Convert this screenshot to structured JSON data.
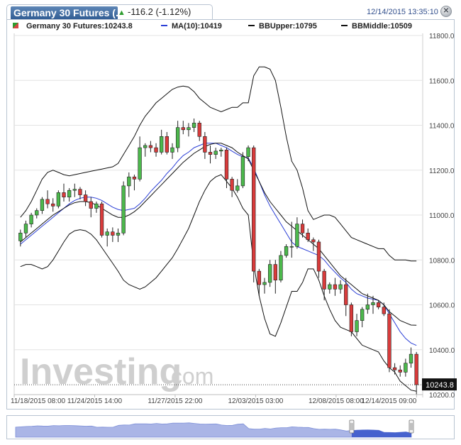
{
  "header": {
    "tab_title": "Germany 30 Futures (...",
    "change_arrow": "▲",
    "change": "-116.2 (-1.12%)",
    "datetime": "12/14/2015 13:35:10",
    "close_icon": "close-icon"
  },
  "legend": {
    "symbol": "Germany 30 Futures:10243.8",
    "ma": "MA(10):10419",
    "bb_upper": "BBUpper:10795",
    "bb_middle": "BBMiddle:10509"
  },
  "colors": {
    "up": "#4cb84c",
    "down": "#d93b3b",
    "ma": "#2b3fd6",
    "bb": "#111111",
    "grid": "#e3e3e3",
    "last_price_bg": "#111111",
    "navigator_fill": "#aab5e6",
    "navigator_selected": "#3553c9"
  },
  "watermark": {
    "brand": "Investing",
    "suffix": ".com"
  },
  "chart_data": {
    "type": "candlestick",
    "title": "Germany 30 Futures",
    "ylim": [
      10200,
      11800
    ],
    "y_ticks": [
      "11800.0",
      "11600.0",
      "11400.0",
      "11200.0",
      "11000.0",
      "10800.0",
      "10600.0",
      "10400.0",
      "10200.0"
    ],
    "x_ticks": [
      "11/18/2015 08:00",
      "11/24/2015 14:00",
      "11/27/2015 22:00",
      "12/03/2015 03:00",
      "12/08/2015 08:00",
      "12/14/2015 09:00"
    ],
    "last_price": "10243.8",
    "grid": true,
    "series": [
      {
        "name": "Germany 30 Futures",
        "kind": "ohlc",
        "candles": [
          [
            10885,
            10935,
            10860,
            10920
          ],
          [
            10920,
            10975,
            10900,
            10960
          ],
          [
            10960,
            11010,
            10945,
            11000
          ],
          [
            11000,
            11030,
            10985,
            11020
          ],
          [
            11020,
            11080,
            11005,
            11070
          ],
          [
            11070,
            11110,
            11030,
            11050
          ],
          [
            11050,
            11075,
            11015,
            11040
          ],
          [
            11040,
            11110,
            11030,
            11100
          ],
          [
            11100,
            11140,
            11060,
            11080
          ],
          [
            11080,
            11120,
            11060,
            11110
          ],
          [
            11110,
            11140,
            11080,
            11115
          ],
          [
            11115,
            11125,
            11070,
            11090
          ],
          [
            11090,
            11110,
            11040,
            11060
          ],
          [
            11060,
            11080,
            10990,
            11030
          ],
          [
            11030,
            11060,
            11010,
            11050
          ],
          [
            11050,
            11060,
            10900,
            10910
          ],
          [
            10910,
            10940,
            10860,
            10925
          ],
          [
            10925,
            10945,
            10880,
            10910
          ],
          [
            10910,
            10940,
            10880,
            10920
          ],
          [
            10920,
            11150,
            10910,
            11130
          ],
          [
            11130,
            11190,
            11080,
            11170
          ],
          [
            11170,
            11180,
            11110,
            11160
          ],
          [
            11160,
            11350,
            11150,
            11300
          ],
          [
            11300,
            11320,
            11260,
            11310
          ],
          [
            11310,
            11330,
            11280,
            11300
          ],
          [
            11300,
            11320,
            11260,
            11280
          ],
          [
            11280,
            11380,
            11270,
            11350
          ],
          [
            11350,
            11370,
            11270,
            11280
          ],
          [
            11280,
            11320,
            11250,
            11300
          ],
          [
            11300,
            11420,
            11280,
            11390
          ],
          [
            11390,
            11420,
            11360,
            11380
          ],
          [
            11380,
            11410,
            11350,
            11390
          ],
          [
            11390,
            11430,
            11370,
            11410
          ],
          [
            11410,
            11420,
            11330,
            11350
          ],
          [
            11350,
            11370,
            11250,
            11280
          ],
          [
            11280,
            11310,
            11230,
            11270
          ],
          [
            11270,
            11300,
            11250,
            11285
          ],
          [
            11285,
            11300,
            11260,
            11290
          ],
          [
            11290,
            11300,
            11120,
            11160
          ],
          [
            11160,
            11170,
            11080,
            11110
          ],
          [
            11110,
            11160,
            11100,
            11130
          ],
          [
            11130,
            11280,
            11120,
            11260
          ],
          [
            11260,
            11310,
            11240,
            11300
          ],
          [
            11300,
            11310,
            10700,
            10750
          ],
          [
            10750,
            10760,
            10640,
            10690
          ],
          [
            10690,
            10720,
            10650,
            10700
          ],
          [
            10700,
            10800,
            10680,
            10780
          ],
          [
            10780,
            10800,
            10650,
            10710
          ],
          [
            10710,
            10840,
            10700,
            10820
          ],
          [
            10820,
            10870,
            10810,
            10860
          ],
          [
            10860,
            10970,
            10810,
            10860
          ],
          [
            10860,
            10990,
            10850,
            10960
          ],
          [
            10960,
            10980,
            10900,
            10920
          ],
          [
            10920,
            10940,
            10880,
            10890
          ],
          [
            10890,
            10900,
            10840,
            10880
          ],
          [
            10880,
            10890,
            10720,
            10750
          ],
          [
            10750,
            10760,
            10620,
            10670
          ],
          [
            10670,
            10700,
            10650,
            10690
          ],
          [
            10690,
            10720,
            10640,
            10670
          ],
          [
            10670,
            10710,
            10650,
            10690
          ],
          [
            10690,
            10720,
            10550,
            10600
          ],
          [
            10600,
            10610,
            10460,
            10480
          ],
          [
            10480,
            10560,
            10460,
            10530
          ],
          [
            10530,
            10590,
            10500,
            10580
          ],
          [
            10580,
            10650,
            10560,
            10600
          ],
          [
            10600,
            10640,
            10560,
            10610
          ],
          [
            10610,
            10620,
            10580,
            10590
          ],
          [
            10590,
            10610,
            10550,
            10560
          ],
          [
            10560,
            10580,
            10300,
            10320
          ],
          [
            10320,
            10340,
            10290,
            10310
          ],
          [
            10310,
            10330,
            10280,
            10300
          ],
          [
            10300,
            10360,
            10280,
            10340
          ],
          [
            10340,
            10410,
            10320,
            10380
          ],
          [
            10380,
            10390,
            10200,
            10244
          ]
        ]
      },
      {
        "name": "MA(10)",
        "kind": "line",
        "values": [
          10870,
          10890,
          10910,
          10930,
          10950,
          10970,
          10990,
          11010,
          11030,
          11050,
          11065,
          11075,
          11080,
          11080,
          11075,
          11065,
          11050,
          11035,
          11025,
          11020,
          11025,
          11030,
          11050,
          11075,
          11105,
          11130,
          11155,
          11185,
          11210,
          11240,
          11265,
          11280,
          11300,
          11310,
          11320,
          11320,
          11320,
          11310,
          11300,
          11285,
          11270,
          11260,
          11255,
          11210,
          11150,
          11090,
          11040,
          11000,
          10960,
          10920,
          10880,
          10860,
          10850,
          10840,
          10830,
          10820,
          10800,
          10770,
          10745,
          10720,
          10700,
          10670,
          10650,
          10640,
          10630,
          10625,
          10620,
          10600,
          10560,
          10520,
          10480,
          10450,
          10430,
          10419
        ]
      },
      {
        "name": "BBUpper",
        "kind": "line",
        "values": [
          10990,
          11020,
          11060,
          11110,
          11160,
          11190,
          11200,
          11190,
          11180,
          11175,
          11180,
          11185,
          11190,
          11195,
          11200,
          11205,
          11210,
          11215,
          11230,
          11270,
          11310,
          11350,
          11400,
          11440,
          11470,
          11500,
          11520,
          11540,
          11560,
          11570,
          11575,
          11570,
          11550,
          11520,
          11500,
          11480,
          11470,
          11460,
          11470,
          11480,
          11480,
          11500,
          11500,
          11620,
          11660,
          11660,
          11650,
          11600,
          11480,
          11350,
          11240,
          11200,
          11120,
          11020,
          10980,
          10990,
          11000,
          11000,
          10990,
          10960,
          10930,
          10900,
          10890,
          10880,
          10870,
          10860,
          10850,
          10850,
          10820,
          10800,
          10800,
          10800,
          10795,
          10795
        ]
      },
      {
        "name": "BBMiddle",
        "kind": "line",
        "values": [
          10880,
          10900,
          10920,
          10940,
          10960,
          10980,
          11000,
          11015,
          11030,
          11045,
          11055,
          11060,
          11060,
          11055,
          11045,
          11030,
          11015,
          11000,
          10990,
          10990,
          11000,
          11015,
          11035,
          11060,
          11085,
          11110,
          11135,
          11160,
          11185,
          11210,
          11235,
          11255,
          11275,
          11290,
          11305,
          11315,
          11320,
          11320,
          11310,
          11300,
          11280,
          11265,
          11250,
          11200,
          11150,
          11100,
          11060,
          11030,
          11000,
          10970,
          10950,
          10930,
          10910,
          10890,
          10870,
          10850,
          10820,
          10790,
          10760,
          10730,
          10710,
          10690,
          10670,
          10650,
          10640,
          10630,
          10620,
          10600,
          10570,
          10550,
          10530,
          10520,
          10510,
          10509
        ]
      },
      {
        "name": "BBLower",
        "kind": "line",
        "values": [
          10770,
          10780,
          10780,
          10770,
          10760,
          10770,
          10800,
          10840,
          10880,
          10915,
          10930,
          10935,
          10930,
          10915,
          10890,
          10855,
          10820,
          10785,
          10750,
          10710,
          10690,
          10680,
          10670,
          10680,
          10700,
          10720,
          10750,
          10780,
          10810,
          10850,
          10895,
          10940,
          11000,
          11060,
          11110,
          11150,
          11170,
          11180,
          11150,
          11120,
          11080,
          11030,
          11000,
          10780,
          10640,
          10540,
          10470,
          10460,
          10520,
          10590,
          10660,
          10660,
          10700,
          10760,
          10760,
          10710,
          10640,
          10580,
          10530,
          10500,
          10490,
          10480,
          10450,
          10420,
          10410,
          10400,
          10390,
          10350,
          10320,
          10300,
          10260,
          10240,
          10220,
          10215
        ]
      }
    ]
  }
}
